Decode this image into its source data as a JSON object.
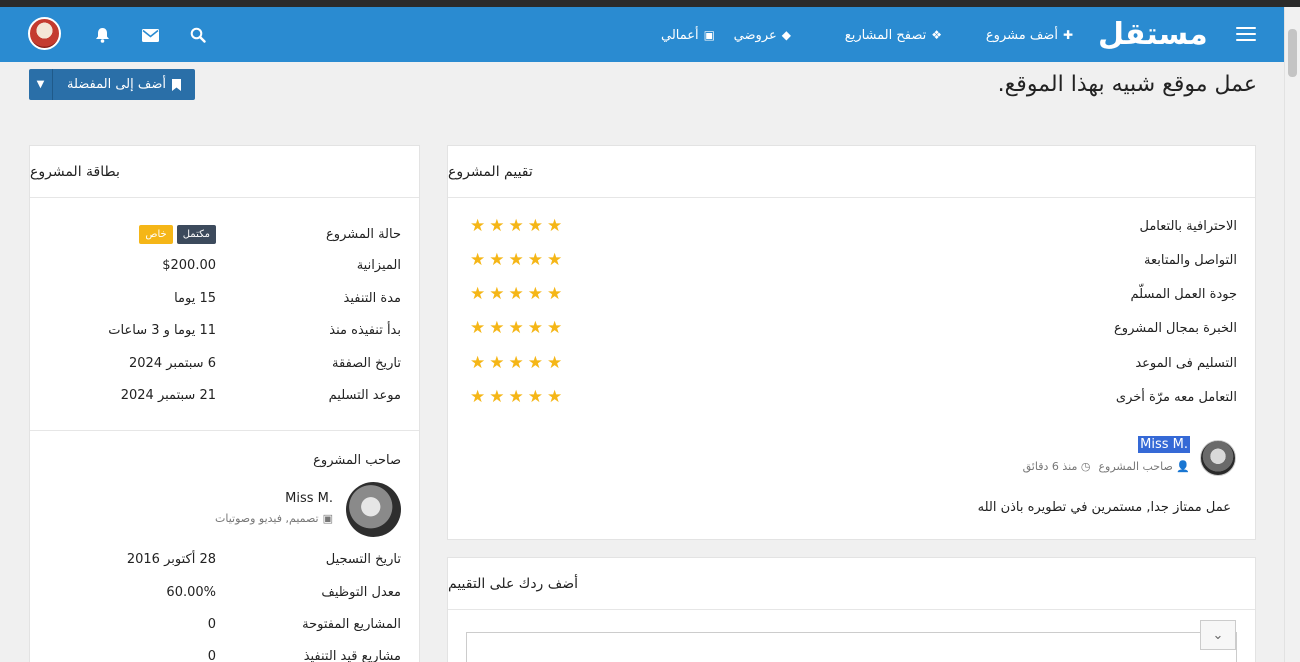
{
  "navbar": {
    "logo": "مستقل",
    "items": [
      {
        "label": "أضف مشروع",
        "icon": "plus-icon",
        "glyph": "✚"
      },
      {
        "label": "تصفح المشاريع",
        "icon": "cubes-icon",
        "glyph": "❖"
      },
      {
        "label": "عروضي",
        "icon": "ticket-icon",
        "glyph": "◆"
      },
      {
        "label": "أعمالي",
        "icon": "briefcase-icon",
        "glyph": "▣"
      }
    ]
  },
  "page": {
    "title": "عمل موقع شبيه بهذا الموقع.",
    "favorite_label": "أضف إلى المفضلة"
  },
  "rating": {
    "heading": "تقييم المشروع",
    "criteria": [
      {
        "label": "الاحترافية بالتعامل",
        "stars": 5
      },
      {
        "label": "التواصل والمتابعة",
        "stars": 5
      },
      {
        "label": "جودة العمل المسلّم",
        "stars": 5
      },
      {
        "label": "الخبرة بمجال المشروع",
        "stars": 5
      },
      {
        "label": "التسليم فى الموعد",
        "stars": 5
      },
      {
        "label": "التعامل معه مرّة أخرى",
        "stars": 5
      }
    ],
    "reviewer": {
      "name": "Miss M.",
      "role": "صاحب المشروع",
      "time": "منذ 6 دقائق"
    },
    "comment": "عمل ممتاز جدا, مستمرين في تطويره باذن الله"
  },
  "reply": {
    "heading": "أضف ردك على التقييم"
  },
  "project_card": {
    "heading": "بطاقة المشروع",
    "status_label": "حالة المشروع",
    "status_badges": [
      "مكتمل",
      "خاص"
    ],
    "rows": [
      {
        "label": "الميزانية",
        "value": "$200.00"
      },
      {
        "label": "مدة التنفيذ",
        "value": "15 يوما"
      },
      {
        "label": "بدأ تنفيذه منذ",
        "value": "11 يوما و 3 ساعات"
      },
      {
        "label": "تاريخ الصفقة",
        "value": "6 سبتمبر 2024"
      },
      {
        "label": "موعد التسليم",
        "value": "21 سبتمبر 2024"
      }
    ],
    "owner_heading": "صاحب المشروع",
    "owner": {
      "name": "Miss M.",
      "skill": "تصميم, فيديو وصوتيات"
    },
    "owner_rows": [
      {
        "label": "تاريخ التسجيل",
        "value": "28 أكتوبر 2016"
      },
      {
        "label": "معدل التوظيف",
        "value": "60.00%"
      },
      {
        "label": "المشاريع المفتوحة",
        "value": "0"
      },
      {
        "label": "مشاريع قيد التنفيذ",
        "value": "0"
      }
    ]
  }
}
